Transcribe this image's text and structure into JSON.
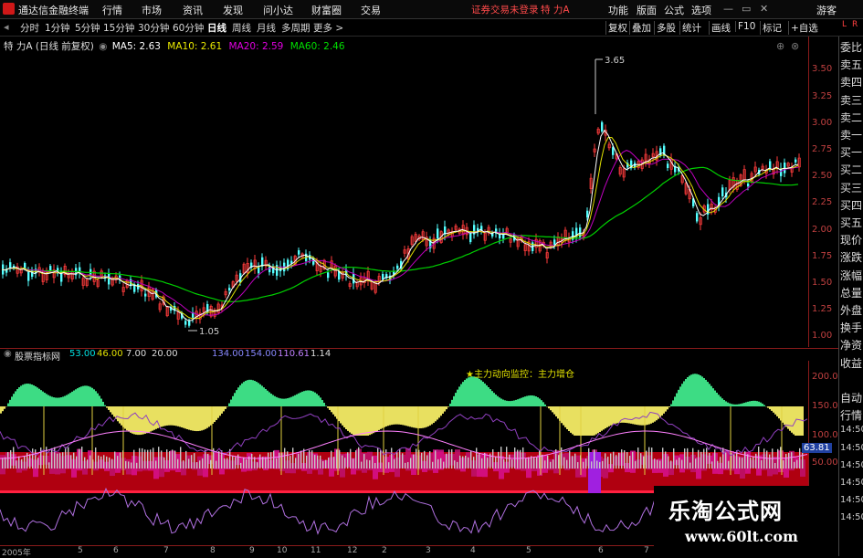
{
  "app": {
    "title": "通达信金融终端",
    "menu": [
      "行情",
      "市场",
      "资讯",
      "发现",
      "问小达",
      "财富圈",
      "交易"
    ],
    "alert": "证券交易未登录",
    "stock_name": "特 力A",
    "right_menu": [
      "功能",
      "版面",
      "公式",
      "选项"
    ],
    "guest": "游客"
  },
  "periods": [
    "分时",
    "1分钟",
    "5分钟",
    "15分钟",
    "30分钟",
    "60分钟",
    "日线",
    "周线",
    "月线",
    "多周期",
    "更多 >"
  ],
  "selected_period": "日线",
  "toolbar_right": [
    "复权",
    "叠加",
    "多股",
    "统计",
    "画线",
    "F10",
    "标记",
    "+自选"
  ],
  "corner": {
    "l": "L",
    "r": "R"
  },
  "main_info": {
    "name": "特 力A (日线 前复权)",
    "ma5": "MA5: 2.63",
    "ma10": "MA10: 2.61",
    "ma20": "MA20: 2.59",
    "ma60": "MA60: 2.46"
  },
  "main_scale": [
    "3.50",
    "3.25",
    "3.00",
    "2.75",
    "2.50",
    "2.25",
    "2.00",
    "1.75",
    "1.50",
    "1.25",
    "1.00"
  ],
  "annotations": {
    "high": "3.65",
    "low": "1.05"
  },
  "right_panel": [
    "委比",
    "卖五",
    "卖四",
    "卖三",
    "卖二",
    "卖一",
    "买一",
    "买二",
    "买三",
    "买四",
    "买五",
    "现价",
    "涨跌",
    "涨幅",
    "总量",
    "外盘",
    "换手",
    "净资",
    "收益",
    "",
    "自动",
    "行情",
    "14:50",
    "14:50",
    "14:50",
    "14:50",
    "14:50",
    "14:50"
  ],
  "indicator": {
    "name": "股票指标网",
    "values": [
      "53.00",
      "46.00",
      "7.00",
      "20.00",
      "134.00",
      "154.00",
      "110.61",
      "1.14"
    ],
    "label": "★主力动向监控：主力增仓",
    "scale": [
      "200.0",
      "150.0",
      "100.0",
      "50.00"
    ],
    "cur": "63.81"
  },
  "dates": [
    "2005年",
    "5",
    "6",
    "7",
    "8",
    "9",
    "10",
    "11",
    "12",
    "2",
    "3",
    "4",
    "5",
    "6",
    "7"
  ],
  "watermark": {
    "cn": "乐淘公式网",
    "url": "www.60lt.com"
  },
  "colors": {
    "up": "#ff3c3c",
    "down": "#54ffff",
    "ma5": "#ffffff",
    "ma10": "#ffff00",
    "ma20": "#ff00ff",
    "ma60": "#00ff00",
    "frame": "#8a1b1b"
  }
}
